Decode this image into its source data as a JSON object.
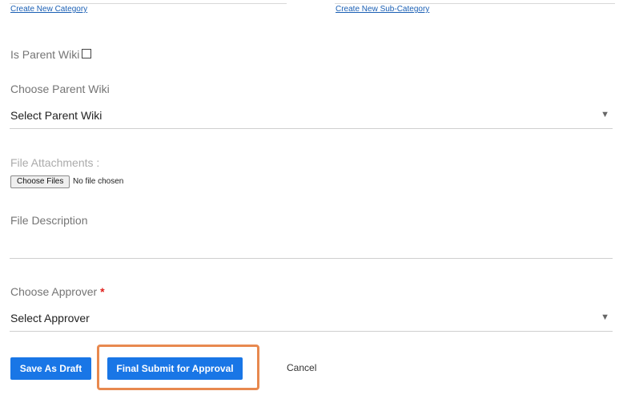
{
  "links": {
    "create_category": "Create New Category",
    "create_subcategory": "Create New Sub-Category"
  },
  "parent_wiki": {
    "checkbox_label": "Is Parent Wiki",
    "checked": false,
    "choose_label": "Choose Parent Wiki",
    "select_value": "Select Parent Wiki"
  },
  "attachments": {
    "label": "File Attachments :",
    "button_label": "Choose Files",
    "status": "No file chosen"
  },
  "file_description": {
    "label": "File Description",
    "value": ""
  },
  "approver": {
    "label": "Choose Approver",
    "required_mark": "*",
    "select_value": "Select Approver"
  },
  "actions": {
    "save_draft": "Save As Draft",
    "final_submit": "Final Submit for Approval",
    "cancel": "Cancel"
  },
  "icons": {
    "dropdown_caret": "▼"
  },
  "colors": {
    "primary_button": "#1976e6",
    "link": "#1a5fb4",
    "required": "#e0201c",
    "highlight_border": "#e8894f"
  }
}
